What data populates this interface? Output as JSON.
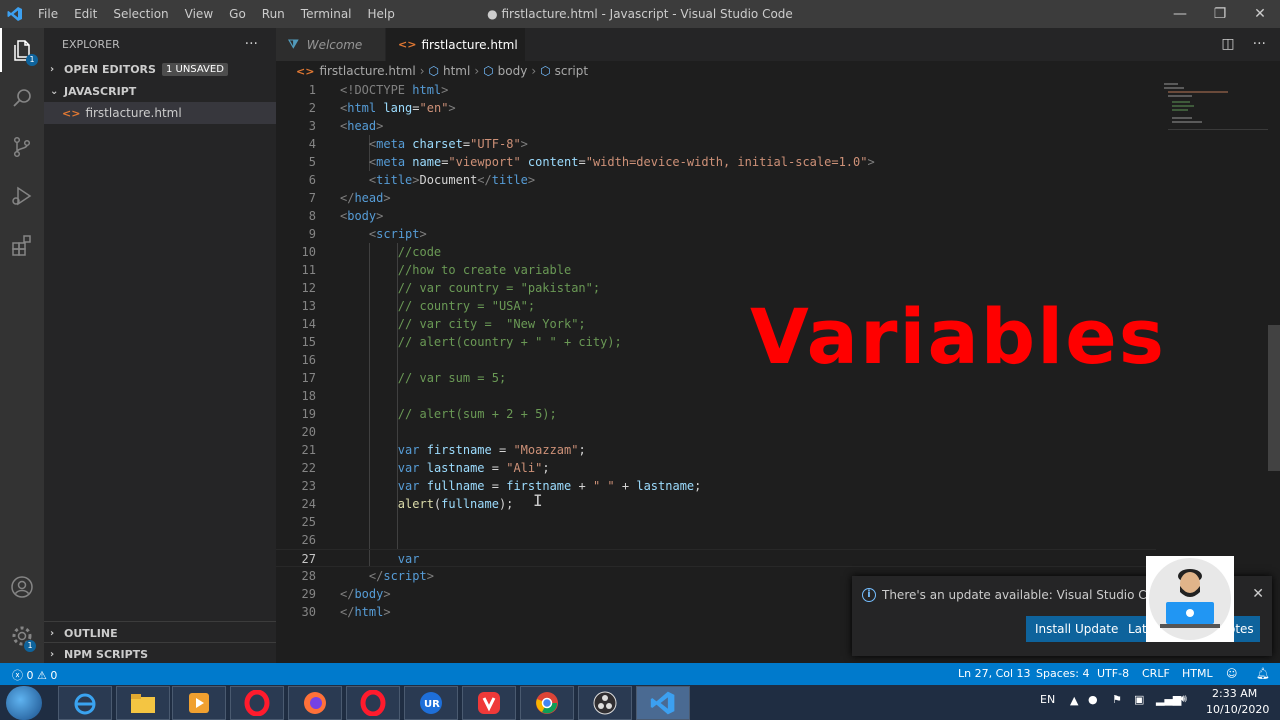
{
  "titlebar": {
    "menu": [
      "File",
      "Edit",
      "Selection",
      "View",
      "Go",
      "Run",
      "Terminal",
      "Help"
    ],
    "title": "● firstlacture.html - Javascript - Visual Studio Code",
    "controls": [
      "—",
      "❐",
      "✕"
    ]
  },
  "activity": {
    "explorer_badge": "1",
    "settings_badge": "1"
  },
  "sidebar": {
    "title": "EXPLORER",
    "more": "···",
    "open_editors": "OPEN EDITORS",
    "unsaved_badge": "1 UNSAVED",
    "folder": "JAVASCRIPT",
    "file": "firstlacture.html",
    "outline": "OUTLINE",
    "npm_scripts": "NPM SCRIPTS"
  },
  "tabs": {
    "welcome": "Welcome",
    "active": "firstlacture.html"
  },
  "breadcrumb": {
    "file": "firstlacture.html",
    "html": "html",
    "body": "body",
    "script": "script"
  },
  "editor": {
    "line_numbers": [
      "1",
      "2",
      "3",
      "4",
      "5",
      "6",
      "7",
      "8",
      "9",
      "10",
      "11",
      "12",
      "13",
      "14",
      "15",
      "16",
      "17",
      "18",
      "19",
      "20",
      "21",
      "22",
      "23",
      "24",
      "25",
      "26",
      "27",
      "28",
      "29",
      "30"
    ],
    "current_line": 27
  },
  "overlay": {
    "title": "Variables",
    "title_color": "#ff0000"
  },
  "notification": {
    "message": "There's an update available: Visual Studio Code 1.",
    "install_label": "Install Update",
    "later_label": "Lat",
    "notes_label": "otes"
  },
  "statusbar": {
    "problems": "0",
    "warnings": "0",
    "position": "Ln 27, Col 13",
    "spaces": "Spaces: 4",
    "encoding": "UTF-8",
    "eol": "CRLF",
    "language": "HTML"
  },
  "taskbar": {
    "lang": "EN",
    "time": "2:33 AM",
    "date": "10/10/2020"
  },
  "colors": {
    "accent": "#007acc",
    "editor_bg": "#1e1e1e",
    "sidebar_bg": "#252526"
  }
}
